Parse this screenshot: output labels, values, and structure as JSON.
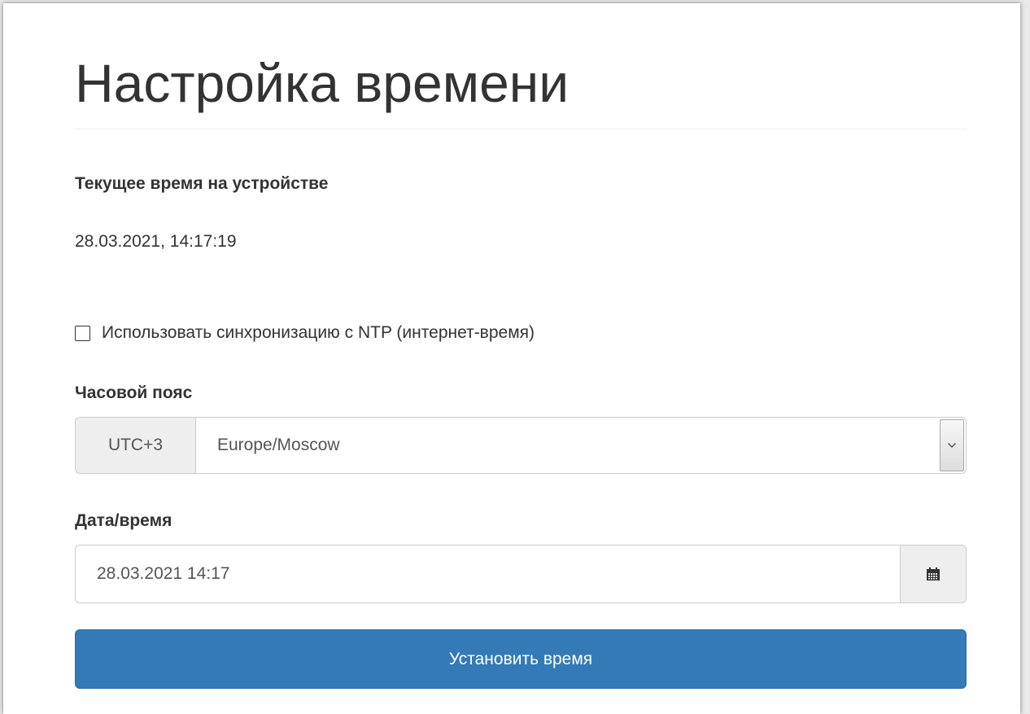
{
  "page": {
    "title": "Настройка времени"
  },
  "current_time": {
    "label": "Текущее время на устройстве",
    "value": "28.03.2021, 14:17:19"
  },
  "ntp": {
    "label": "Использовать синхронизацию с NTP (интернет-время)",
    "checked": false
  },
  "timezone": {
    "label": "Часовой пояс",
    "offset": "UTC+3",
    "selected": "Europe/Moscow"
  },
  "datetime": {
    "label": "Дата/время",
    "value": "28.03.2021 14:17",
    "icon": "calendar-icon"
  },
  "submit": {
    "label": "Установить время"
  },
  "colors": {
    "primary": "#337ab7",
    "text": "#333333",
    "addon_bg": "#eeeeee",
    "border": "#cccccc"
  }
}
